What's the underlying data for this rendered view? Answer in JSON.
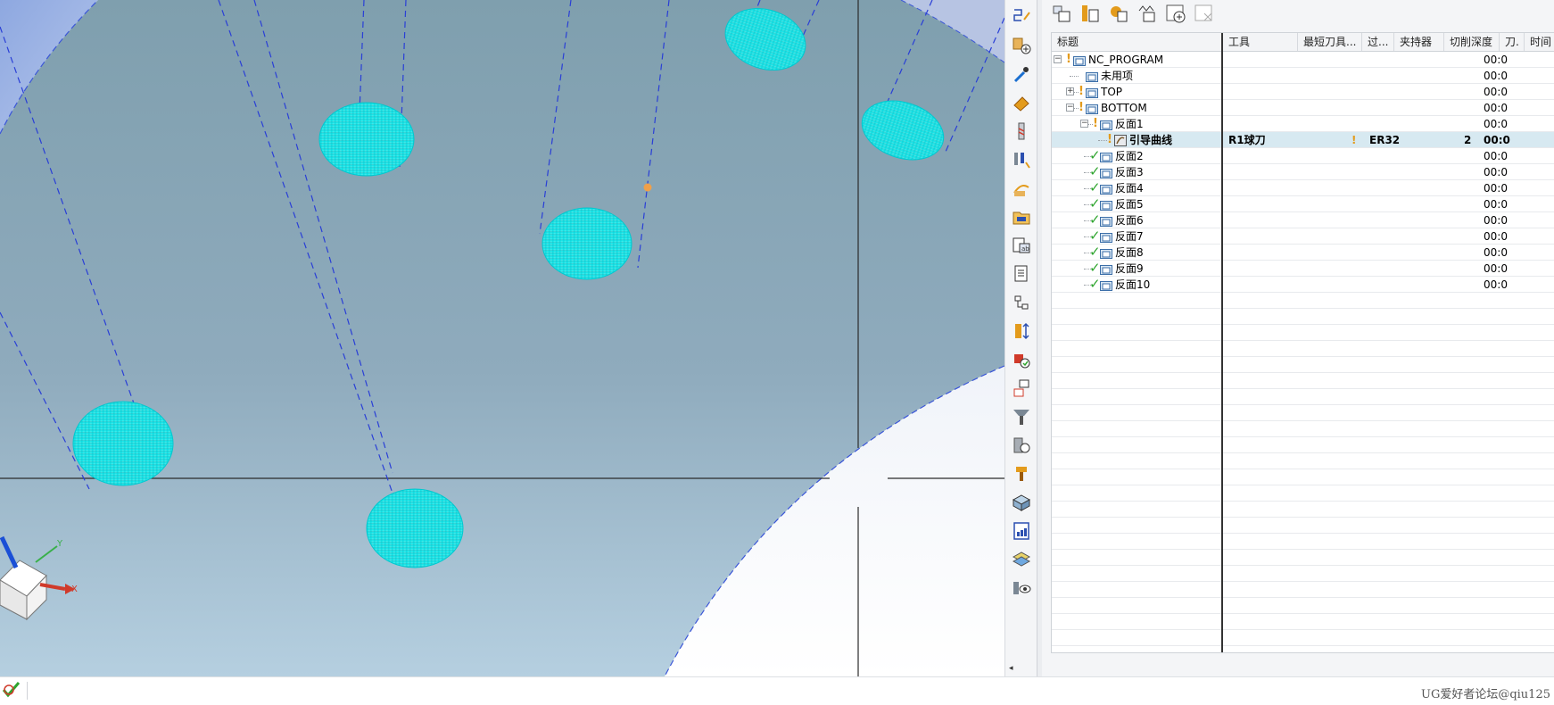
{
  "viewport": {
    "background_color": "#8ba7ba",
    "toolpath_color": "#1ee8ea",
    "axis_labels": {
      "x": "X",
      "y": "Y"
    }
  },
  "side_toolbar": {
    "icons": [
      "sketch-tool-icon",
      "create-geometry-icon",
      "eyedropper-icon",
      "eraser-icon",
      "end-mill-icon",
      "tool-holder-icon",
      "display-toolpath-icon",
      "program-folder-icon",
      "operation-list-icon",
      "shop-doc-icon",
      "process-flow-icon",
      "tool-length-icon",
      "verify-icon",
      "feature-copy-icon",
      "spindle-icon",
      "machine-config-icon",
      "part-holder-icon",
      "3d-solid-icon",
      "calculator-icon",
      "layer-visibility-icon",
      "view-eye-icon"
    ]
  },
  "navigator": {
    "toolbar_icons": [
      "program-order-view-icon",
      "machine-tool-view-icon",
      "geometry-view-icon",
      "method-view-icon",
      "create-operation-icon",
      "delete-operation-icon"
    ],
    "columns": [
      "标题",
      "工具",
      "最短刀具...",
      "过...",
      "夹持器",
      "切削深度",
      "刀.",
      "时间"
    ],
    "rows": [
      {
        "name": "NC_PROGRAM",
        "level": 0,
        "expander": "−",
        "status": "flag",
        "tool": "",
        "warn": "",
        "holder": "",
        "count": "",
        "time": "00:0"
      },
      {
        "name": "未用项",
        "level": 1,
        "expander": "",
        "status": "",
        "tool": "",
        "warn": "",
        "holder": "",
        "count": "",
        "time": "00:0"
      },
      {
        "name": "TOP",
        "level": 1,
        "expander": "+",
        "status": "flag",
        "tool": "",
        "warn": "",
        "holder": "",
        "count": "",
        "time": "00:0"
      },
      {
        "name": "BOTTOM",
        "level": 1,
        "expander": "−",
        "status": "flag",
        "tool": "",
        "warn": "",
        "holder": "",
        "count": "",
        "time": "00:0"
      },
      {
        "name": "反面1",
        "level": 2,
        "expander": "−",
        "status": "flag",
        "tool": "",
        "warn": "",
        "holder": "",
        "count": "",
        "time": "00:0"
      },
      {
        "name": "引导曲线",
        "level": 3,
        "expander": "",
        "status": "flag",
        "tool": "R1球刀",
        "warn": "!",
        "holder": "ER32",
        "count": "2",
        "time": "00:0",
        "selected": true,
        "operation": true
      },
      {
        "name": "反面2",
        "level": 2,
        "expander": "",
        "status": "check",
        "tool": "",
        "warn": "",
        "holder": "",
        "count": "",
        "time": "00:0"
      },
      {
        "name": "反面3",
        "level": 2,
        "expander": "",
        "status": "check",
        "tool": "",
        "warn": "",
        "holder": "",
        "count": "",
        "time": "00:0"
      },
      {
        "name": "反面4",
        "level": 2,
        "expander": "",
        "status": "check",
        "tool": "",
        "warn": "",
        "holder": "",
        "count": "",
        "time": "00:0"
      },
      {
        "name": "反面5",
        "level": 2,
        "expander": "",
        "status": "check",
        "tool": "",
        "warn": "",
        "holder": "",
        "count": "",
        "time": "00:0"
      },
      {
        "name": "反面6",
        "level": 2,
        "expander": "",
        "status": "check",
        "tool": "",
        "warn": "",
        "holder": "",
        "count": "",
        "time": "00:0"
      },
      {
        "name": "反面7",
        "level": 2,
        "expander": "",
        "status": "check",
        "tool": "",
        "warn": "",
        "holder": "",
        "count": "",
        "time": "00:0"
      },
      {
        "name": "反面8",
        "level": 2,
        "expander": "",
        "status": "check",
        "tool": "",
        "warn": "",
        "holder": "",
        "count": "",
        "time": "00:0"
      },
      {
        "name": "反面9",
        "level": 2,
        "expander": "",
        "status": "check",
        "tool": "",
        "warn": "",
        "holder": "",
        "count": "",
        "time": "00:0"
      },
      {
        "name": "反面10",
        "level": 2,
        "expander": "",
        "status": "check",
        "tool": "",
        "warn": "",
        "holder": "",
        "count": "",
        "time": "00:0"
      }
    ]
  },
  "status_bar": {
    "watermark": "UG爱好者论坛@qiu125"
  }
}
